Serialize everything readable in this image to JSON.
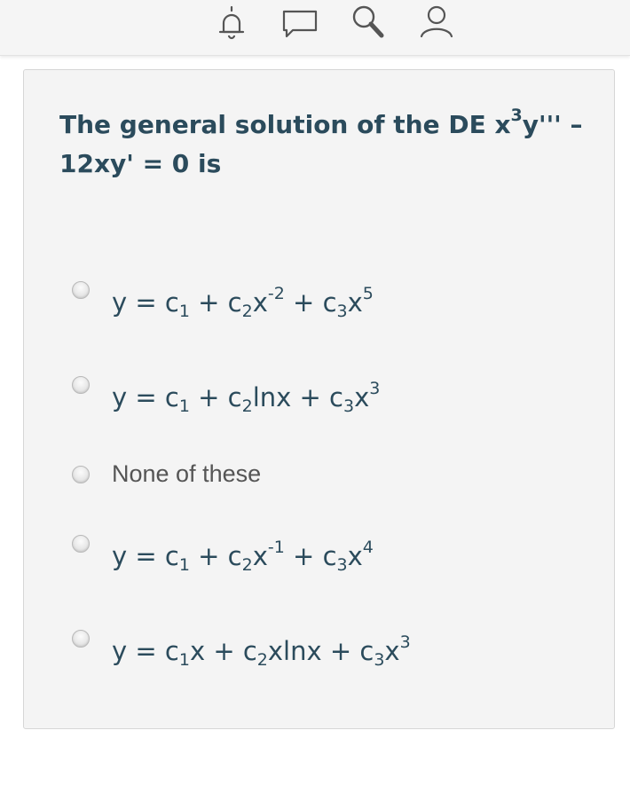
{
  "header": {
    "icons": [
      "bell-icon",
      "comment-icon",
      "search-icon",
      "user-icon"
    ],
    "icon_color": "#555555",
    "background": "#f5f5f5"
  },
  "question": {
    "line1_pre": "The general solution of the DE x",
    "line1_exp": "3",
    "line1_post": "y'''  –",
    "line2": "12xy' = 0 is"
  },
  "options": [
    {
      "y": "y = c",
      "s1": "1",
      "t1": " + c",
      "s2": "2",
      "t2": "x",
      "e2": "-2",
      "t3": " + c",
      "s3": "3",
      "t4": "x",
      "e3": "5"
    },
    {
      "y": "y = c",
      "s1": "1",
      "t1": " + c",
      "s2": "2",
      "t2": "lnx + c",
      "s3": "3",
      "t3": "x",
      "e3": "3"
    },
    {
      "text": "None of these"
    },
    {
      "y": "y = c",
      "s1": "1",
      "t1": " + c",
      "s2": "2",
      "t2": "x",
      "e2": "-1",
      "t3": " + c",
      "s3": "3",
      "t4": "x",
      "e3": "4"
    },
    {
      "y": "y = c",
      "s1": "1",
      "t1": "x + c",
      "s2": "2",
      "t2": "xlnx + c",
      "s3": "3",
      "t3": "x",
      "e3": "3"
    }
  ],
  "colors": {
    "text": "#2b4b5c",
    "plain_text": "#555555",
    "card_bg": "#f4f4f4",
    "card_border": "#d6d6d6"
  }
}
